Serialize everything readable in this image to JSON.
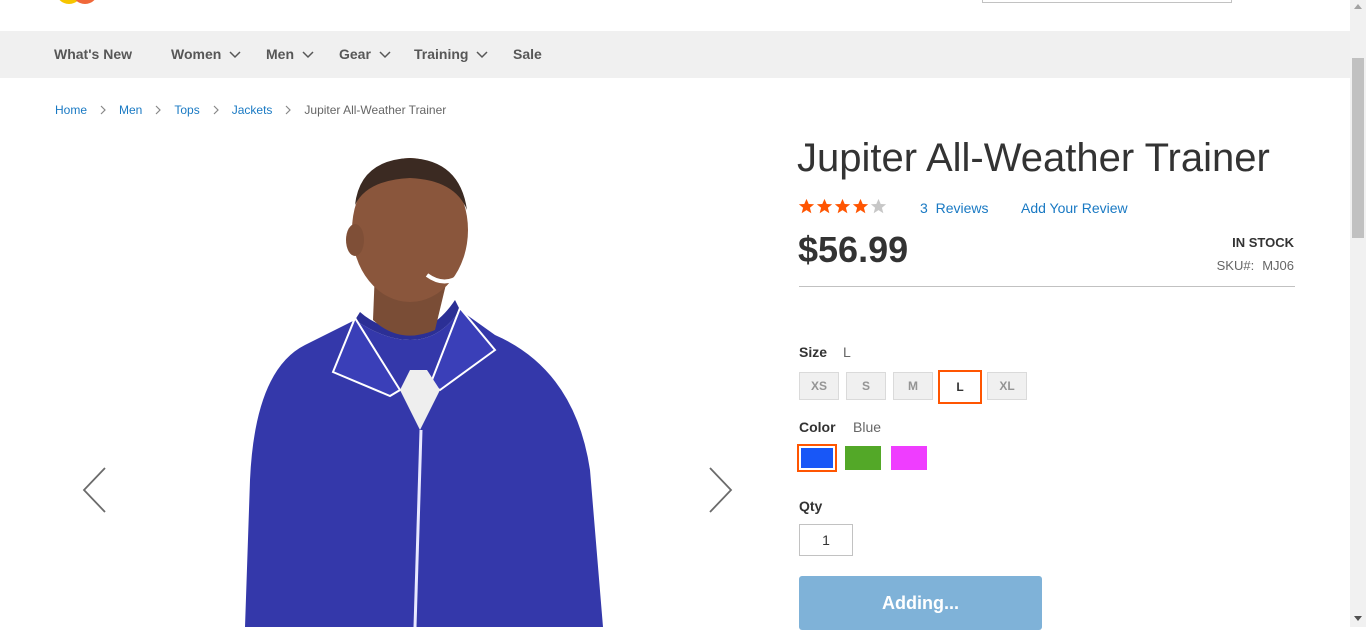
{
  "nav": {
    "items": [
      {
        "label": "What's New",
        "dropdown": false
      },
      {
        "label": "Women",
        "dropdown": true
      },
      {
        "label": "Men",
        "dropdown": true
      },
      {
        "label": "Gear",
        "dropdown": true
      },
      {
        "label": "Training",
        "dropdown": true
      },
      {
        "label": "Sale",
        "dropdown": false
      }
    ]
  },
  "breadcrumb": {
    "links": [
      "Home",
      "Men",
      "Tops",
      "Jackets"
    ],
    "current": "Jupiter All-Weather Trainer"
  },
  "product": {
    "title": "Jupiter All-Weather Trainer",
    "rating_stars": 4,
    "rating_max": 5,
    "reviews_count": "3",
    "reviews_label": "Reviews",
    "add_review_label": "Add Your Review",
    "price": "$56.99",
    "stock": "IN STOCK",
    "sku_label": "SKU#:",
    "sku": "MJ06"
  },
  "options": {
    "size_label": "Size",
    "size_selected": "L",
    "sizes": [
      "XS",
      "S",
      "M",
      "L",
      "XL"
    ],
    "color_label": "Color",
    "color_selected": "Blue",
    "colors": [
      {
        "name": "Blue",
        "hex": "#1857f7",
        "selected": true
      },
      {
        "name": "Green",
        "hex": "#53a828",
        "selected": false
      },
      {
        "name": "Purple",
        "hex": "#ef3dff",
        "selected": false
      }
    ]
  },
  "qty": {
    "label": "Qty",
    "value": "1"
  },
  "cart": {
    "button_label": "Adding..."
  },
  "colors": {
    "link": "#1979c3",
    "star_filled": "#ff5501",
    "star_empty": "#c7c7c7",
    "button_bg": "#7fb2d8",
    "jacket": "#3236a8"
  },
  "icons": {
    "gallery_prev": "chevron-left-icon",
    "gallery_next": "chevron-right-icon",
    "nav_dropdown": "chevron-down-icon"
  }
}
